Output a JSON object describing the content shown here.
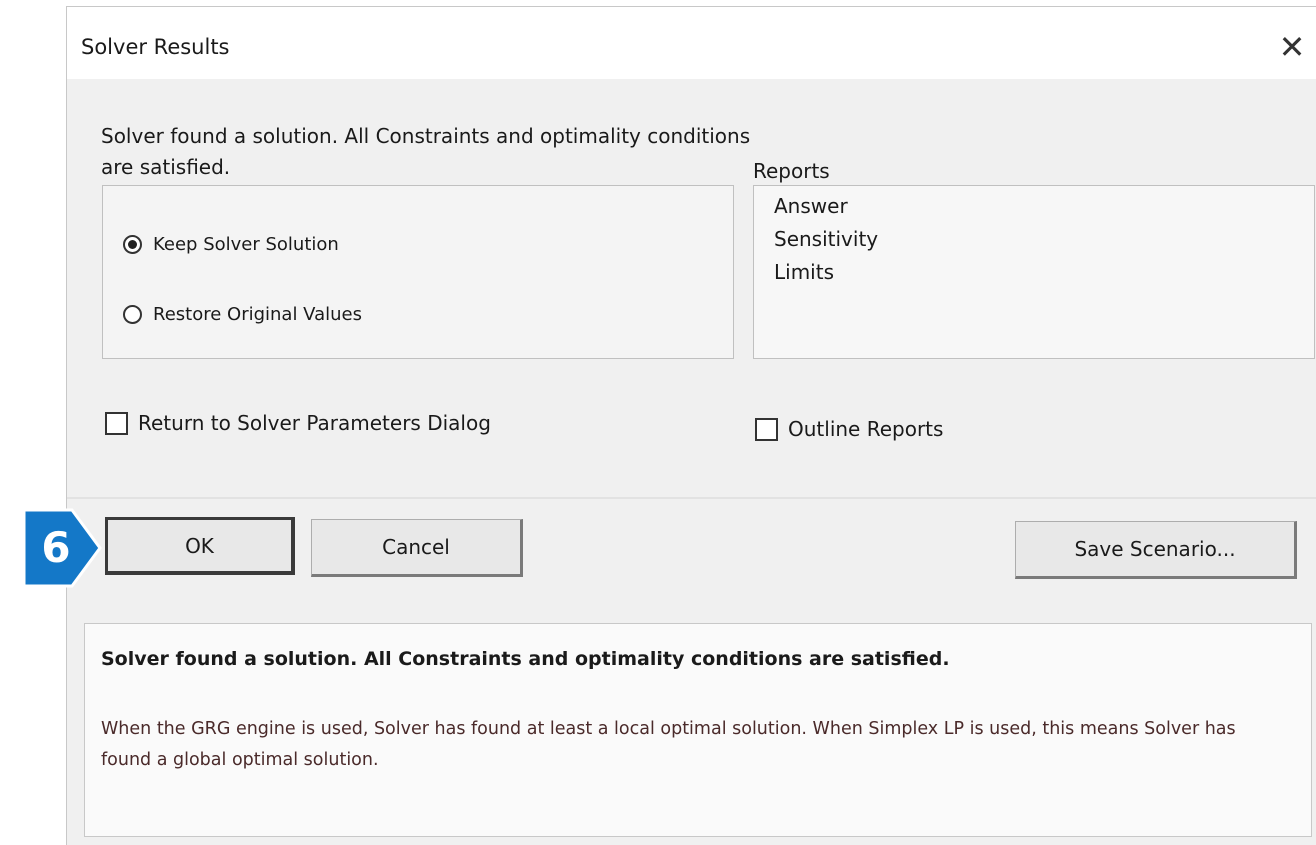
{
  "dialog": {
    "title": "Solver Results",
    "close_glyph": "✕"
  },
  "status_message": "Solver found a solution.  All Constraints and optimality conditions are satisfied.",
  "solution_options": {
    "items": [
      {
        "label": "Keep Solver Solution",
        "selected": true
      },
      {
        "label": "Restore Original Values",
        "selected": false
      }
    ]
  },
  "reports": {
    "label": "Reports",
    "items": [
      "Answer",
      "Sensitivity",
      "Limits"
    ]
  },
  "checkboxes": {
    "return_to_params": {
      "label": "Return to Solver Parameters Dialog",
      "checked": false
    },
    "outline_reports": {
      "label": "Outline Reports",
      "checked": false
    }
  },
  "buttons": {
    "ok": "OK",
    "cancel": "Cancel",
    "save_scenario": "Save Scenario..."
  },
  "step_callout": {
    "number": "6",
    "color": "#1478c8"
  },
  "info": {
    "headline": "Solver found a solution.  All Constraints and optimality conditions are satisfied.",
    "detail": "When the GRG engine is used, Solver has found at least a local optimal solution. When Simplex LP is used, this means Solver has found a global optimal solution."
  }
}
